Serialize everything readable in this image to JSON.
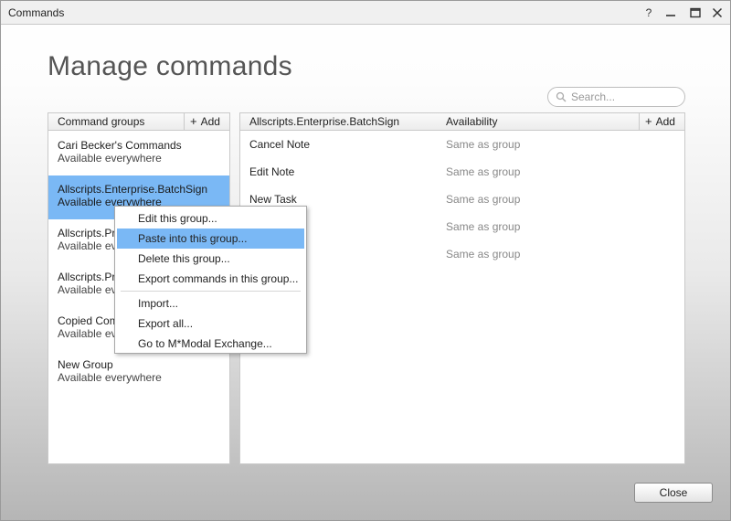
{
  "window": {
    "title": "Commands",
    "help_label": "?"
  },
  "page": {
    "title": "Manage commands"
  },
  "search": {
    "placeholder": "Search..."
  },
  "groups_panel": {
    "header": "Command groups",
    "add_label": "Add",
    "items": [
      {
        "name": "Cari Becker's Commands",
        "availability": "Available everywhere",
        "selected": false
      },
      {
        "name": "Allscripts.Enterprise.BatchSign",
        "availability": "Available everywhere",
        "selected": true
      },
      {
        "name": "Allscripts.Pro",
        "availability": "Available eve",
        "selected": false
      },
      {
        "name": "Allscripts.Pro",
        "availability": "Available eve",
        "selected": false
      },
      {
        "name": "Copied Com",
        "availability": "Available eve",
        "selected": false
      },
      {
        "name": "New Group",
        "availability": "Available everywhere",
        "selected": false
      }
    ]
  },
  "commands_panel": {
    "header_name": "Allscripts.Enterprise.BatchSign",
    "header_availability": "Availability",
    "add_label": "Add",
    "rows": [
      {
        "name": "Cancel Note",
        "availability": "Same as group"
      },
      {
        "name": "Edit Note",
        "availability": "Same as group"
      },
      {
        "name": "New Task",
        "availability": "Same as group"
      },
      {
        "name": "",
        "availability": "Same as group"
      },
      {
        "name": "",
        "availability": "Same as group"
      }
    ]
  },
  "context_menu": {
    "items": [
      {
        "label": "Edit this group...",
        "highlighted": false
      },
      {
        "label": "Paste into this group...",
        "highlighted": true
      },
      {
        "label": "Delete this group...",
        "highlighted": false
      },
      {
        "label": "Export commands in this group...",
        "highlighted": false
      },
      {
        "label": "Import...",
        "highlighted": false
      },
      {
        "label": "Export all...",
        "highlighted": false
      },
      {
        "label": "Go to M*Modal Exchange...",
        "highlighted": false
      }
    ]
  },
  "footer": {
    "close_label": "Close"
  }
}
